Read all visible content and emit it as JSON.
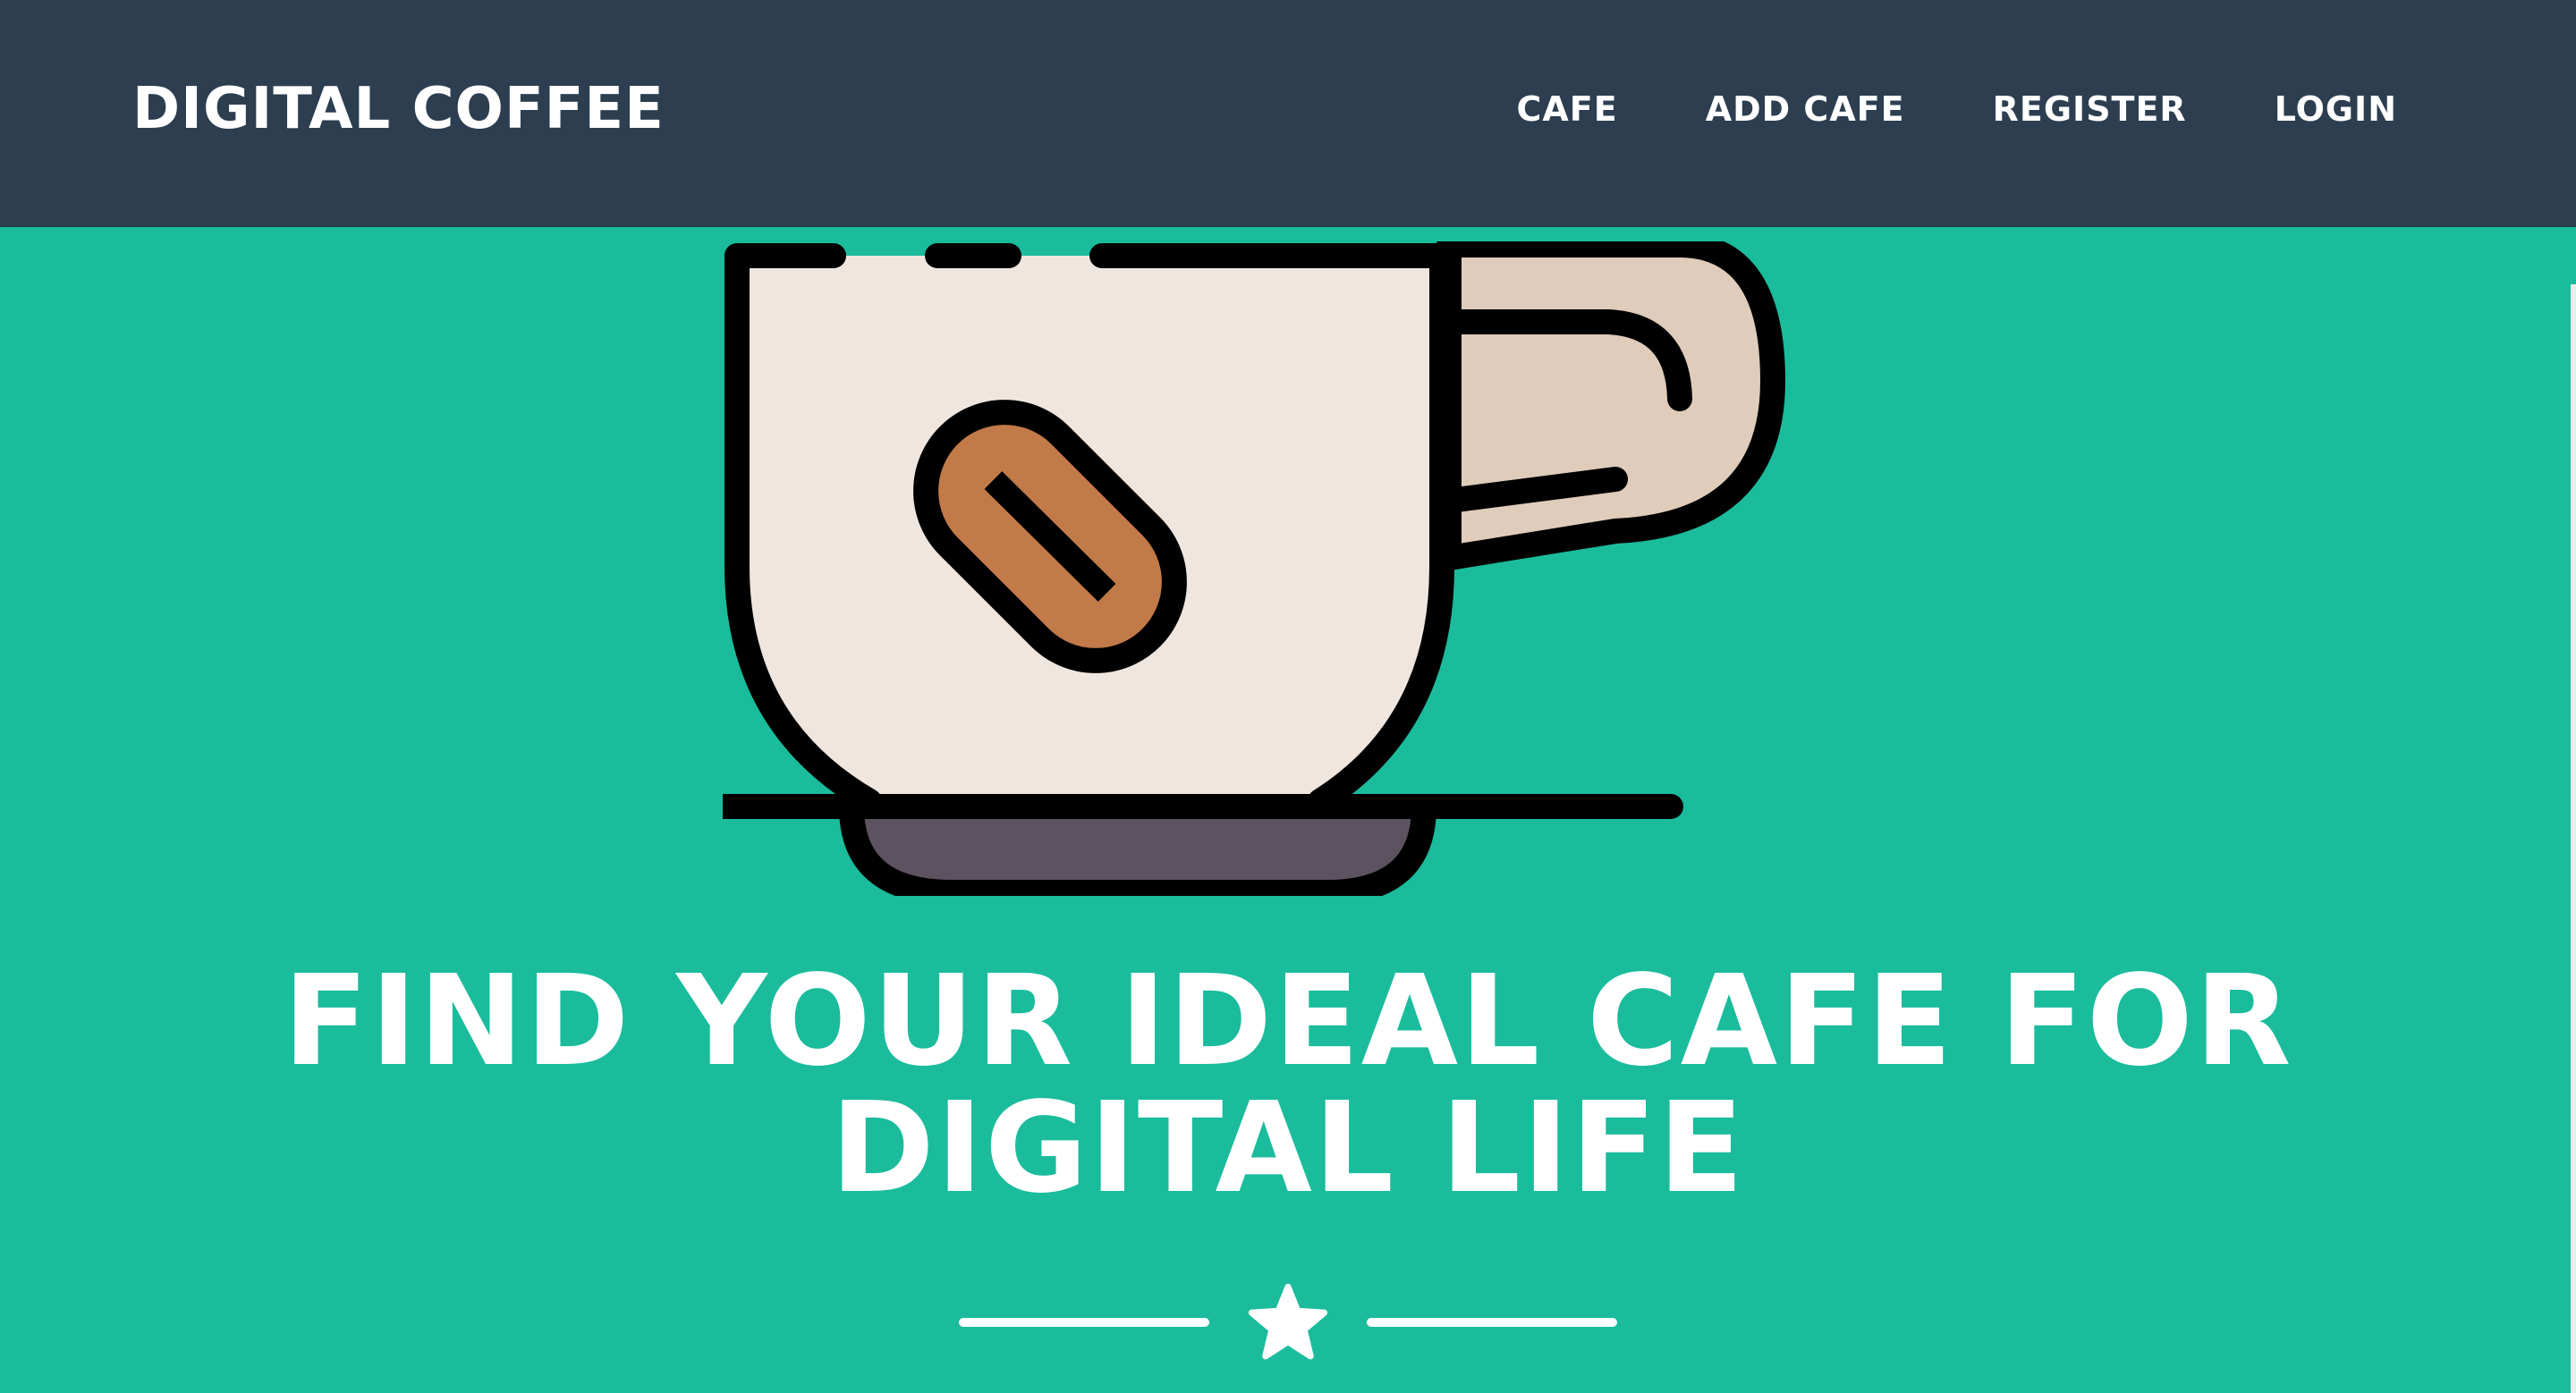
{
  "navbar": {
    "brand": "DIGITAL COFFEE",
    "links": [
      {
        "label": "CAFE"
      },
      {
        "label": "ADD CAFE"
      },
      {
        "label": "REGISTER"
      },
      {
        "label": "LOGIN"
      }
    ]
  },
  "masthead": {
    "avatar_icon": "coffee-cup-icon",
    "heading": "FIND YOUR IDEAL CAFE FOR DIGITAL LIFE",
    "divider_icon": "star-icon"
  },
  "colors": {
    "navbar_bg": "#2c3e50",
    "masthead_bg": "#1abc9c",
    "cup_body": "#efe6df",
    "cup_handle": "#e0ccbb",
    "coffee_bean": "#c17a48",
    "saucer": "#5d5260",
    "outline": "#000000",
    "text": "#ffffff"
  }
}
